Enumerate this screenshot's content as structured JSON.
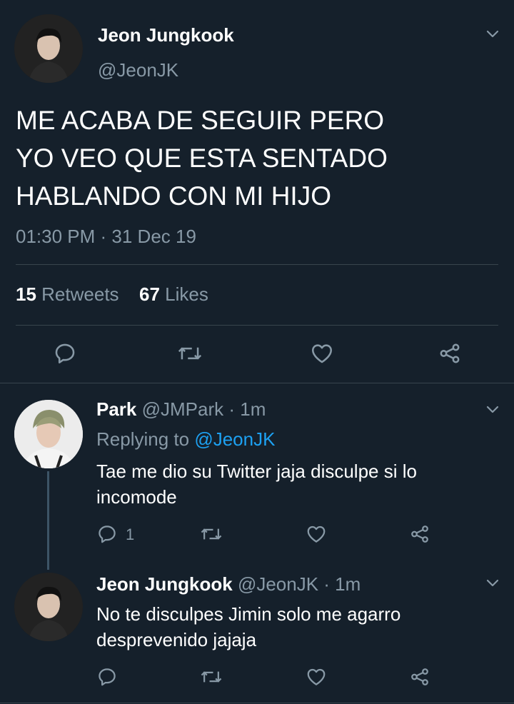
{
  "main_tweet": {
    "author_name": "Jeon Jungkook",
    "author_handle": "@JeonJK",
    "text_line1": "ME ACABA DE SEGUIR PERO",
    "text_line2": "YO VEO QUE ESTA SENTADO",
    "text_line3": "HABLANDO CON MI HIJO",
    "timestamp": "01:30 PM · 31 Dec 19",
    "retweets_count": "15",
    "retweets_label": "Retweets",
    "likes_count": "67",
    "likes_label": "Likes"
  },
  "reply1": {
    "author_name": "Park",
    "author_handle": "@JMPark",
    "time": "· 1m",
    "replying_to_label": "Replying to",
    "replying_to_handle": "@JeonJK",
    "text_line1": "Tae me dio su Twitter jaja disculpe si lo",
    "text_line2": "incomode",
    "reply_count": "1"
  },
  "reply2": {
    "author_name": "Jeon Jungkook",
    "author_handle": "@JeonJK",
    "time": "· 1m",
    "text_line1": "No te disculpes Jimin solo me agarro",
    "text_line2": "desprevenido jajaja"
  },
  "icons": {
    "reply": "reply-icon",
    "retweet": "retweet-icon",
    "like": "heart-icon",
    "share": "share-icon",
    "more": "chevron-down-icon"
  },
  "colors": {
    "background": "#15202b",
    "text": "#ffffff",
    "muted": "#8899a6",
    "accent": "#1da1f2",
    "divider": "#38444d"
  }
}
